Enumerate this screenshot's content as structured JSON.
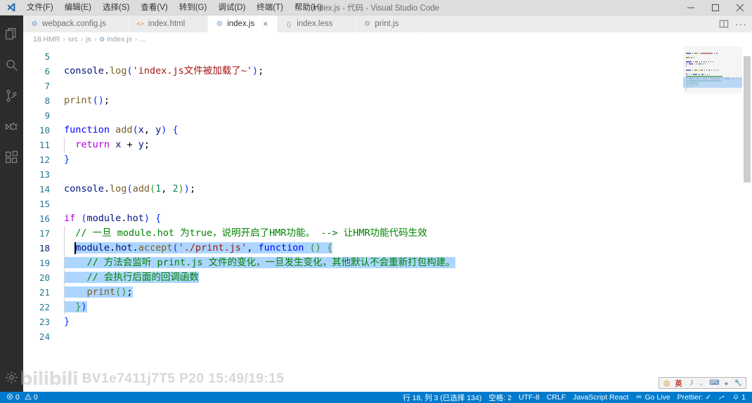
{
  "window": {
    "title": "index.js - 代码 - Visual Studio Code",
    "logo_icon": "vscode-logo",
    "minimize_icon": "minimize-icon",
    "maximize_icon": "maximize-icon",
    "close_icon": "close-icon"
  },
  "menubar": {
    "items": [
      {
        "label": "文件(F)",
        "name": "menu-file"
      },
      {
        "label": "编辑(E)",
        "name": "menu-edit"
      },
      {
        "label": "选择(S)",
        "name": "menu-selection"
      },
      {
        "label": "查看(V)",
        "name": "menu-view"
      },
      {
        "label": "转到(G)",
        "name": "menu-go"
      },
      {
        "label": "调试(D)",
        "name": "menu-debug"
      },
      {
        "label": "终端(T)",
        "name": "menu-terminal"
      },
      {
        "label": "帮助(H)",
        "name": "menu-help"
      }
    ]
  },
  "activitybar": {
    "items": [
      {
        "name": "explorer-icon",
        "label": "资源管理器"
      },
      {
        "name": "search-icon",
        "label": "搜索"
      },
      {
        "name": "source-control-icon",
        "label": "源代码管理"
      },
      {
        "name": "debug-icon",
        "label": "调试"
      },
      {
        "name": "extensions-icon",
        "label": "扩展"
      }
    ],
    "bottom": [
      {
        "name": "settings-gear-icon",
        "label": "管理"
      }
    ]
  },
  "tabs": [
    {
      "label": "webpack.config.js",
      "icon": "js-file-icon",
      "icon_glyph": "⚙",
      "icon_color": "#6f9ec9",
      "active": false
    },
    {
      "label": "index.html",
      "icon": "html-file-icon",
      "icon_glyph": "<>",
      "icon_color": "#e37933",
      "active": false
    },
    {
      "label": "index.js",
      "icon": "js-file-icon",
      "icon_glyph": "⚙",
      "icon_color": "#6f9ec9",
      "active": true
    },
    {
      "label": "index.less",
      "icon": "less-file-icon",
      "icon_glyph": "{}",
      "icon_color": "#a0a0a0",
      "active": false
    },
    {
      "label": "print.js",
      "icon": "js-file-icon",
      "icon_glyph": "⚙",
      "icon_color": "#6f9ec9",
      "active": false
    }
  ],
  "editor_actions": [
    {
      "name": "split-editor-icon",
      "label": "拆分编辑器"
    },
    {
      "name": "more-actions-icon",
      "label": "更多操作"
    }
  ],
  "breadcrumb": {
    "items": [
      "18.HMR",
      "src",
      "js",
      "index.js",
      "..."
    ],
    "separator": "›",
    "file_icon": "js-file-icon"
  },
  "code": {
    "first_visible_line": 5,
    "cursor_line": 18,
    "selection_color": "#add6ff",
    "lines": [
      {
        "n": 5,
        "tokens": []
      },
      {
        "n": 6,
        "tokens": [
          {
            "t": "console",
            "c": "t-var"
          },
          {
            "t": ".",
            "c": "t-pun"
          },
          {
            "t": "log",
            "c": "t-fn"
          },
          {
            "t": "(",
            "c": "t-par1"
          },
          {
            "t": "'index.js文件被加载了~'",
            "c": "t-str"
          },
          {
            "t": ")",
            "c": "t-par1"
          },
          {
            "t": ";",
            "c": "t-pun"
          }
        ]
      },
      {
        "n": 7,
        "tokens": []
      },
      {
        "n": 8,
        "tokens": [
          {
            "t": "print",
            "c": "t-fn"
          },
          {
            "t": "()",
            "c": "t-par1"
          },
          {
            "t": ";",
            "c": "t-pun"
          }
        ]
      },
      {
        "n": 9,
        "tokens": []
      },
      {
        "n": 10,
        "tokens": [
          {
            "t": "function",
            "c": "t-key"
          },
          {
            "t": " ",
            "c": "t-plain"
          },
          {
            "t": "add",
            "c": "t-fn"
          },
          {
            "t": "(",
            "c": "t-par1"
          },
          {
            "t": "x",
            "c": "t-var"
          },
          {
            "t": ", ",
            "c": "t-pun"
          },
          {
            "t": "y",
            "c": "t-var"
          },
          {
            "t": ")",
            "c": "t-par1"
          },
          {
            "t": " ",
            "c": "t-plain"
          },
          {
            "t": "{",
            "c": "t-par1"
          }
        ]
      },
      {
        "n": 11,
        "tokens": [
          {
            "t": "  ",
            "c": "t-plain"
          },
          {
            "t": "return",
            "c": "t-ctrl"
          },
          {
            "t": " ",
            "c": "t-plain"
          },
          {
            "t": "x",
            "c": "t-var"
          },
          {
            "t": " + ",
            "c": "t-pun"
          },
          {
            "t": "y",
            "c": "t-var"
          },
          {
            "t": ";",
            "c": "t-pun"
          }
        ]
      },
      {
        "n": 12,
        "tokens": [
          {
            "t": "}",
            "c": "t-par1"
          }
        ]
      },
      {
        "n": 13,
        "tokens": []
      },
      {
        "n": 14,
        "tokens": [
          {
            "t": "console",
            "c": "t-var"
          },
          {
            "t": ".",
            "c": "t-pun"
          },
          {
            "t": "log",
            "c": "t-fn"
          },
          {
            "t": "(",
            "c": "t-par1"
          },
          {
            "t": "add",
            "c": "t-fn"
          },
          {
            "t": "(",
            "c": "t-par2"
          },
          {
            "t": "1",
            "c": "t-num"
          },
          {
            "t": ", ",
            "c": "t-pun"
          },
          {
            "t": "2",
            "c": "t-num"
          },
          {
            "t": ")",
            "c": "t-par2"
          },
          {
            "t": ")",
            "c": "t-par1"
          },
          {
            "t": ";",
            "c": "t-pun"
          }
        ]
      },
      {
        "n": 15,
        "tokens": []
      },
      {
        "n": 16,
        "tokens": [
          {
            "t": "if",
            "c": "t-ctrl"
          },
          {
            "t": " ",
            "c": "t-plain"
          },
          {
            "t": "(",
            "c": "t-par1"
          },
          {
            "t": "module",
            "c": "t-var"
          },
          {
            "t": ".",
            "c": "t-pun"
          },
          {
            "t": "hot",
            "c": "t-var"
          },
          {
            "t": ")",
            "c": "t-par1"
          },
          {
            "t": " ",
            "c": "t-plain"
          },
          {
            "t": "{",
            "c": "t-par1"
          }
        ]
      },
      {
        "n": 17,
        "tokens": [
          {
            "t": "  // 一旦 module.hot 为true，说明开启了HMR功能。 --> 让HMR功能代码生效",
            "c": "t-com"
          }
        ]
      },
      {
        "n": 18,
        "cursor": true,
        "sel_start": 2,
        "tokens": [
          {
            "t": "  ",
            "c": "t-plain"
          },
          {
            "t": "module",
            "c": "t-var",
            "sel": true
          },
          {
            "t": ".",
            "c": "t-pun",
            "sel": true
          },
          {
            "t": "hot",
            "c": "t-var",
            "sel": true
          },
          {
            "t": ".",
            "c": "t-pun",
            "sel": true
          },
          {
            "t": "accept",
            "c": "t-fn",
            "sel": true
          },
          {
            "t": "(",
            "c": "t-par1",
            "sel": true
          },
          {
            "t": "'./print.js'",
            "c": "t-str",
            "sel": true
          },
          {
            "t": ", ",
            "c": "t-pun",
            "sel": true
          },
          {
            "t": "function",
            "c": "t-key",
            "sel": true
          },
          {
            "t": " ",
            "c": "t-plain",
            "sel": true
          },
          {
            "t": "()",
            "c": "t-par2",
            "sel": true
          },
          {
            "t": " ",
            "c": "t-plain",
            "sel": true
          },
          {
            "t": "{",
            "c": "t-par2",
            "sel": true
          }
        ]
      },
      {
        "n": 19,
        "tokens": [
          {
            "t": "    // 方法会监听 print.js 文件的变化，一旦发生变化，其他默认不会重新打包构建。",
            "c": "t-com",
            "sel": true
          }
        ]
      },
      {
        "n": 20,
        "tokens": [
          {
            "t": "    // 会执行后面的回调函数",
            "c": "t-com",
            "sel": true
          }
        ]
      },
      {
        "n": 21,
        "tokens": [
          {
            "t": "    ",
            "c": "t-plain",
            "sel": true
          },
          {
            "t": "print",
            "c": "t-fn",
            "sel": true
          },
          {
            "t": "()",
            "c": "t-par2",
            "sel": true
          },
          {
            "t": ";",
            "c": "t-pun",
            "sel": true
          }
        ]
      },
      {
        "n": 22,
        "tokens": [
          {
            "t": "  ",
            "c": "t-plain",
            "sel": true
          },
          {
            "t": "}",
            "c": "t-par2",
            "sel": true
          },
          {
            "t": ")",
            "c": "t-par1",
            "sel": true
          }
        ]
      },
      {
        "n": 23,
        "tokens": [
          {
            "t": "}",
            "c": "t-par1"
          }
        ]
      },
      {
        "n": 24,
        "tokens": []
      }
    ]
  },
  "statusbar": {
    "errors": "0",
    "warnings": "0",
    "error_icon": "error-circle-icon",
    "warning_icon": "warning-triangle-icon",
    "right_items": [
      {
        "label": "行 18, 列 3 (已选择 134)",
        "name": "cursor-position"
      },
      {
        "label": "空格: 2",
        "name": "indentation"
      },
      {
        "label": "UTF-8",
        "name": "encoding"
      },
      {
        "label": "CRLF",
        "name": "eol"
      },
      {
        "label": "JavaScript React",
        "name": "language-mode"
      },
      {
        "label": "Go Live",
        "name": "go-live",
        "icon": "broadcast-icon"
      },
      {
        "label": "Prettier: ✓",
        "name": "prettier-status"
      }
    ],
    "feedback_icon": "feedback-smiley-icon",
    "bell_icon": "bell-icon",
    "bell_count": "1"
  },
  "watermark": {
    "logo": "bilibili",
    "text": "BV1e7411j7T5 P20 15:49/19:15"
  },
  "ime": {
    "icons": [
      {
        "name": "sogou-logo-icon",
        "glyph": "◍",
        "color": "#e8a33d"
      },
      {
        "name": "language-mode-icon",
        "glyph": "英",
        "color": "#c0392b"
      },
      {
        "name": "moon-icon",
        "glyph": "☽",
        "color": "#3b6fa8"
      },
      {
        "name": "punctuation-icon",
        "glyph": "，",
        "color": "#3b6fa8"
      },
      {
        "name": "soft-keyboard-icon",
        "glyph": "⌨",
        "color": "#3b6fa8"
      },
      {
        "name": "user-icon",
        "glyph": "●",
        "color": "#6a8fbf"
      },
      {
        "name": "toolbox-icon",
        "glyph": "🔧",
        "color": "#3b6fa8"
      }
    ]
  },
  "minimap": {
    "selection_start_line": 18,
    "selection_end_line": 22
  }
}
